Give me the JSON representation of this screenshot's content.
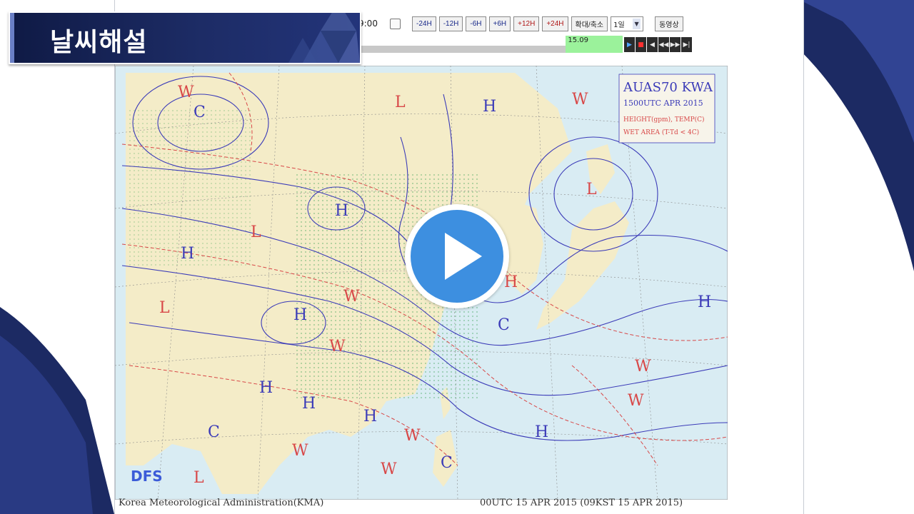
{
  "slide": {
    "title": "날씨해설"
  },
  "toolbar": {
    "time": "9:00",
    "step_buttons": [
      {
        "label": "-24H",
        "kind": "minus"
      },
      {
        "label": "-12H",
        "kind": "minus"
      },
      {
        "label": "-6H",
        "kind": "minus"
      },
      {
        "label": "+6H",
        "kind": "plus"
      },
      {
        "label": "+12H",
        "kind": "plus"
      },
      {
        "label": "+24H",
        "kind": "plus"
      }
    ],
    "zoom_label": "확대/축소",
    "period_select": "1일",
    "animate_label": "동영상"
  },
  "progress": {
    "value_label": "15.09"
  },
  "player": {
    "buttons": [
      "play-icon",
      "stop-icon",
      "first-icon",
      "prev-icon",
      "next-icon",
      "last-icon"
    ]
  },
  "map": {
    "header_line1": "AUAS70 KWA",
    "header_line2": "1500UTC APR 2015",
    "header_line3": "HEIGHT(gpm), TEMP(C)",
    "header_line4": "WET AREA (T-Td < 4C)",
    "brand": "DFS",
    "colors": {
      "land": "#f4ecc8",
      "sea": "#d9ecf3",
      "height": "#3b3bb8",
      "temp": "#d84848"
    },
    "systems": [
      {
        "sym": "H",
        "c": "height"
      },
      {
        "sym": "L",
        "c": "temp"
      },
      {
        "sym": "W",
        "c": "temp"
      },
      {
        "sym": "C",
        "c": "height"
      }
    ]
  },
  "footer": {
    "left": "Korea Meteorological Administration(KMA)",
    "right": "00UTC 15 APR 2015 (09KST 15 APR 2015)"
  },
  "video": {
    "play": "play-icon"
  }
}
